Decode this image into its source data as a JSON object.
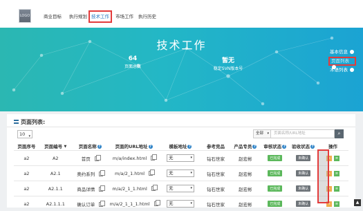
{
  "nav": {
    "logo_text": "LOGO",
    "items": [
      {
        "label": "商业目标",
        "active": false
      },
      {
        "label": "执行规划",
        "active": false
      },
      {
        "label": "技术工作",
        "active": true
      },
      {
        "label": "市场工作",
        "active": false
      },
      {
        "label": "执行历史",
        "active": false
      }
    ]
  },
  "hero": {
    "title": "技术工作",
    "stats": [
      {
        "value": "64",
        "label": "页面总数"
      },
      {
        "value": "暂无",
        "label": "稳定SVN版本号"
      }
    ],
    "side_links": [
      {
        "label": "基本信息",
        "selected": false
      },
      {
        "label": "页面列表",
        "selected": true
      },
      {
        "label": "术语列表",
        "selected": false
      }
    ]
  },
  "panel": {
    "title": "页面列表:",
    "page_size": "10",
    "search_scope": "全部",
    "search_placeholder": "页面名称/URL地址",
    "columns": [
      "页面序号",
      "页面编号",
      "页面名称",
      "页面的URL地址",
      "模板地址",
      "参考竞品",
      "产品专员",
      "审核状态",
      "验收状态",
      "操作"
    ],
    "rows": [
      {
        "seq": "a2",
        "code": "A2",
        "name": "首页",
        "url": "m/a/index.html",
        "template": "无",
        "competitor": "钻石世家",
        "owner": "赵宏彬",
        "review": "已完成",
        "accept": "未确认"
      },
      {
        "seq": "a2",
        "code": "A2.1",
        "name": "奥约系列",
        "url": "m/a/2_1.html",
        "template": "无",
        "competitor": "钻石世家",
        "owner": "赵宏彬",
        "review": "已完成",
        "accept": "未确认"
      },
      {
        "seq": "a2",
        "code": "A2.1.1",
        "name": "商品详情",
        "url": "m/a/2_1_1.html",
        "template": "无",
        "competitor": "钻石世家",
        "owner": "赵宏彬",
        "review": "已完成",
        "accept": "未确认"
      },
      {
        "seq": "a2",
        "code": "A2.1.1.1",
        "name": "确认订单",
        "url": "m/a/2_1_1_1.html",
        "template": "无",
        "competitor": "钻石世家",
        "owner": "赵宏彬",
        "review": "已完成",
        "accept": "未确认"
      }
    ]
  },
  "colors": {
    "accent": "#1ba3d3",
    "highlight_border": "#e33b3b",
    "success": "#5cb85c",
    "pending": "#6e7479",
    "edit": "#f0ad4e"
  }
}
